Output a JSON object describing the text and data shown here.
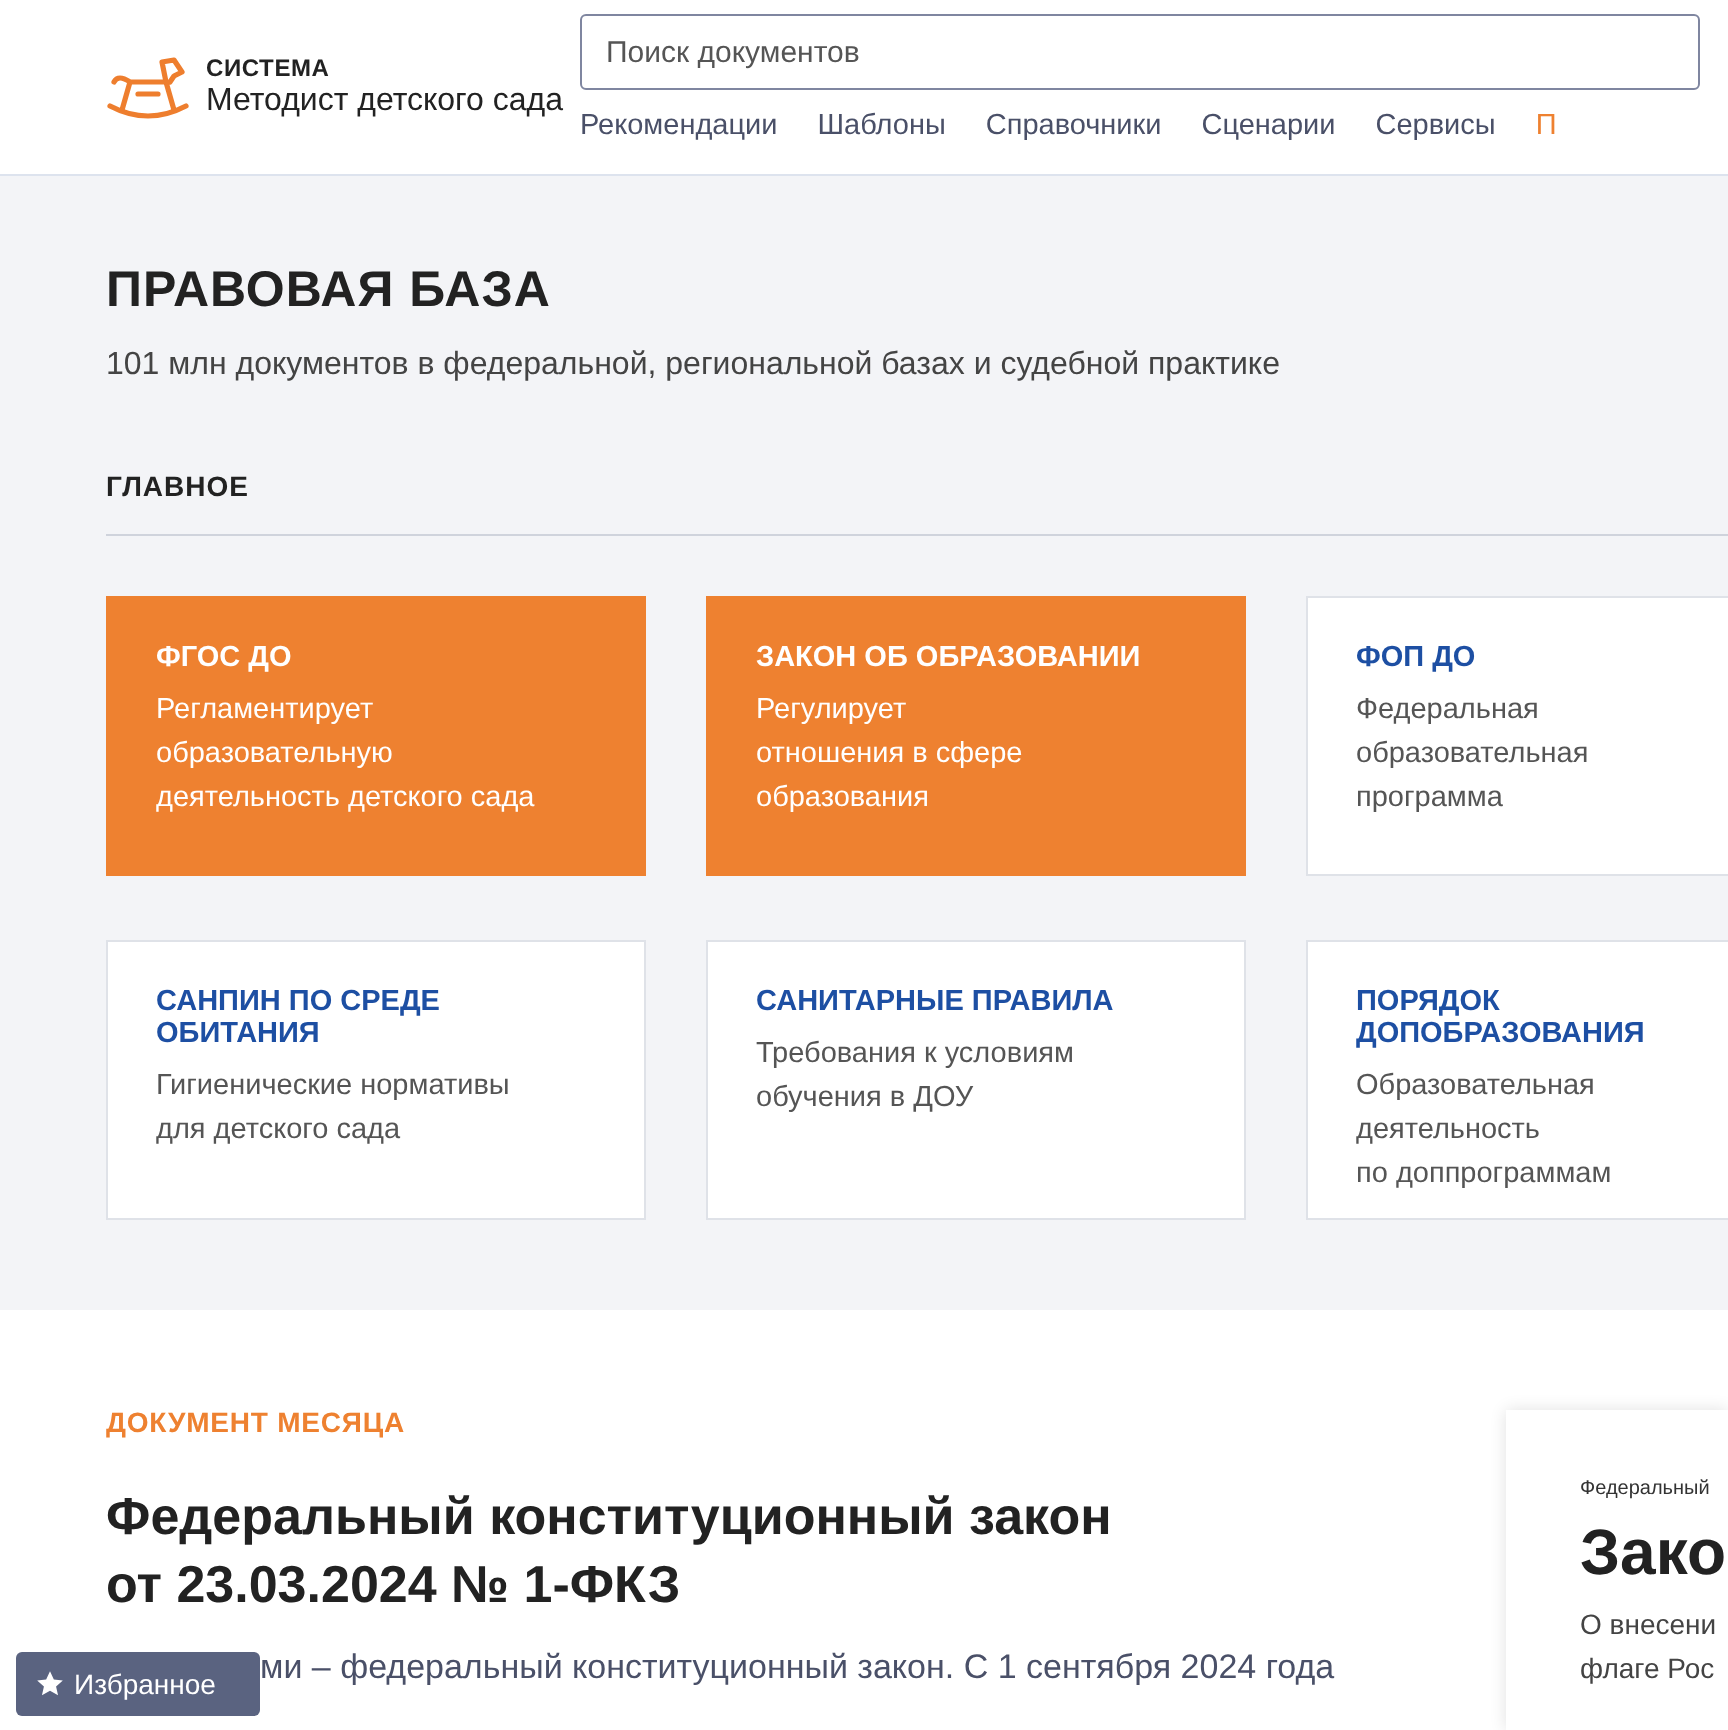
{
  "header": {
    "logo_caption": "СИСТЕМА",
    "logo_title": "Методист детского сада",
    "search": {
      "placeholder": "Поиск документов"
    },
    "nav": [
      {
        "label": "Рекомендации",
        "selected": false
      },
      {
        "label": "Шаблоны",
        "selected": false
      },
      {
        "label": "Справочники",
        "selected": false
      },
      {
        "label": "Сценарии",
        "selected": false
      },
      {
        "label": "Сервисы",
        "selected": false
      },
      {
        "label": "П",
        "selected": true
      }
    ]
  },
  "legal_base": {
    "title": "ПРАВОВАЯ БАЗА",
    "subtitle": "101 млн документов в федеральной, региональной базах и судебной практике",
    "section": "ГЛАВНОЕ",
    "cards": [
      {
        "title": "ФГОС ДО",
        "text": "Регламентирует\nобразовательную\nдеятельность детского сада",
        "highlighted": true
      },
      {
        "title": "ЗАКОН ОБ ОБРАЗОВАНИИ",
        "text": "Регулирует\nотношения в сфере\nобразования",
        "highlighted": true
      },
      {
        "title": "ФОП ДО",
        "text": "Федеральная\nобразовательная\nпрограмма",
        "highlighted": false
      },
      {
        "title": "САНПИН ПО СРЕДЕ ОБИТАНИЯ",
        "text": "Гигиенические нормативы\nдля детского сада",
        "highlighted": false
      },
      {
        "title": "САНИТАРНЫЕ ПРАВИЛА",
        "text": "Требования к условиям\nобучения в ДОУ",
        "highlighted": false
      },
      {
        "title": "ПОРЯДОК ДОПОБРАЗОВАНИЯ",
        "text": "Образовательная\nдеятельность\nпо доппрограммам",
        "highlighted": false
      }
    ]
  },
  "document_of_month": {
    "label": "ДОКУМЕНТ МЕСЯЦА",
    "title": "Федеральный конституционный закон\nот 23.03.2024 № 1-ФКЗ",
    "text": "ми – федеральный конституционный закон. С 1 сентября 2024 года",
    "preview": {
      "caption": "Федеральный",
      "title": "Зако",
      "lines": [
        "О внесени",
        "флаге Рос"
      ]
    }
  },
  "favorites_button": {
    "label": "Избранное"
  }
}
